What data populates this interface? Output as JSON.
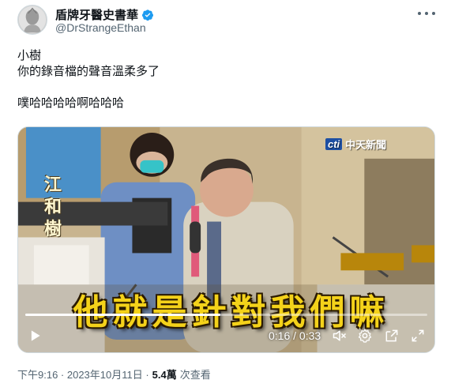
{
  "user": {
    "display_name": "盾牌牙醫史書華",
    "handle": "@DrStrangeEthan",
    "verified": true,
    "avatar_icon": "avatar-portrait"
  },
  "tweet": {
    "lines": [
      "小樹",
      "你的錄音檔的聲音溫柔多了",
      "",
      "噗哈哈哈哈啊哈哈哈"
    ]
  },
  "video": {
    "channel_logo_cti": "cti",
    "channel_logo_text": "中天新聞",
    "side_name": "江和樹",
    "banner_text": "他就是針對我們嘛",
    "current_time": "0:16",
    "duration": "0:33",
    "time_display": "0:16 / 0:33",
    "progress": 0.485
  },
  "footer": {
    "timestamp": "下午9:16 · 2023年10月11日 · ",
    "views_count": "5.4萬",
    "views_label": " 次查看"
  },
  "colors": {
    "text": "#0f1419",
    "secondary": "#536471",
    "verified": "#1d9bf0",
    "banner": "#f4d21a"
  }
}
